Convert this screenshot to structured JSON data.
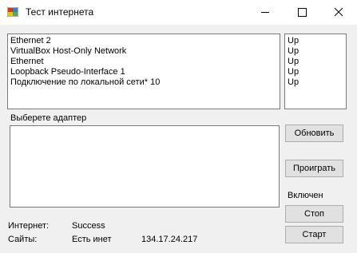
{
  "window": {
    "title": "Тест интернета"
  },
  "adapters": {
    "names": [
      "Ethernet 2",
      "VirtualBox Host-Only Network",
      "Ethernet",
      "Loopback Pseudo-Interface 1",
      "Подключение по локальной сети* 10"
    ],
    "statuses": [
      "Up",
      "Up",
      "Up",
      "Up",
      "Up"
    ]
  },
  "select_label": "Выберете адаптер",
  "buttons": {
    "refresh": "Обновить",
    "play": "Проиграть",
    "stop": "Стоп",
    "start": "Старт"
  },
  "state_text": "Включен",
  "status": {
    "internet_label": "Интернет:",
    "internet_value": "Success",
    "sites_label": "Сайты:",
    "sites_value": "Есть инет",
    "ip_value": "134.17.24.217"
  }
}
